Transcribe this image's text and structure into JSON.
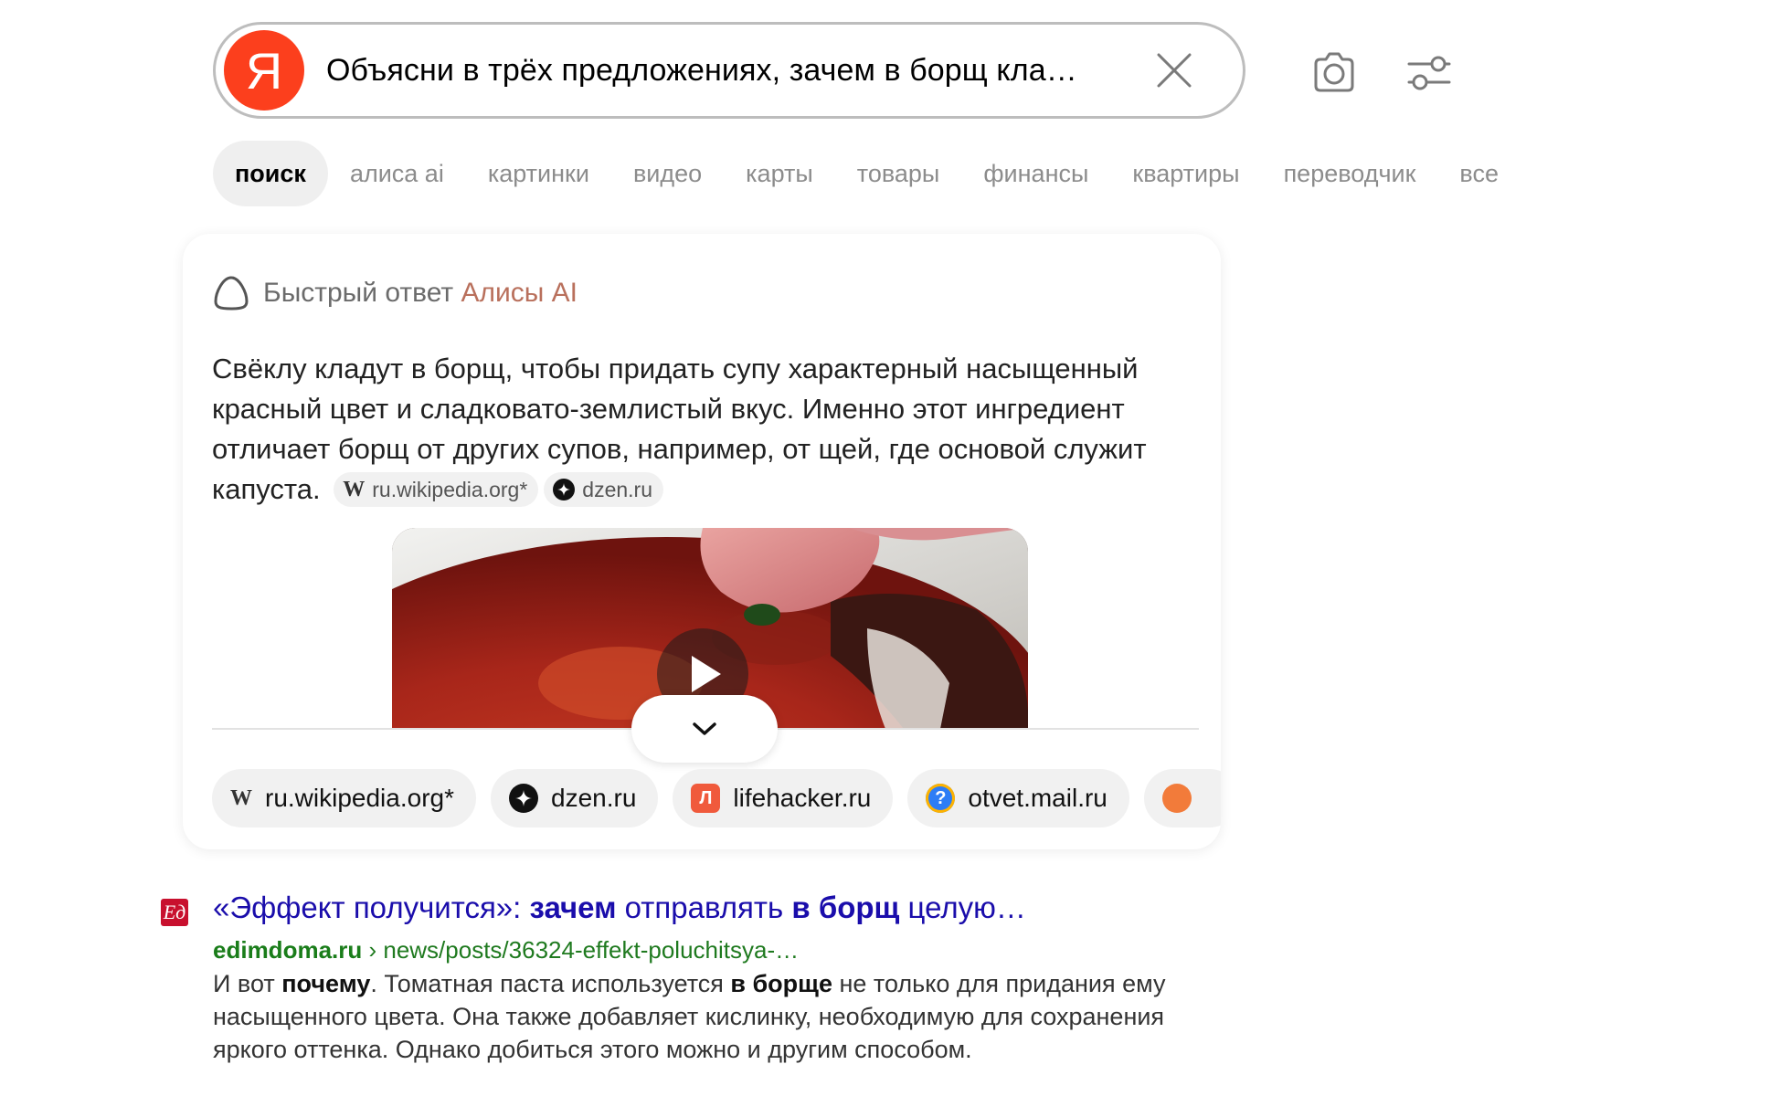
{
  "search": {
    "logo_letter": "Я",
    "query": "Объясни в трёх предложениях, зачем в борщ кла…"
  },
  "tabs": [
    {
      "label": "поиск",
      "active": true
    },
    {
      "label": "алиса ai"
    },
    {
      "label": "картинки"
    },
    {
      "label": "видео"
    },
    {
      "label": "карты"
    },
    {
      "label": "товары"
    },
    {
      "label": "финансы"
    },
    {
      "label": "квартиры"
    },
    {
      "label": "переводчик"
    },
    {
      "label": "все"
    }
  ],
  "alice": {
    "header_prefix": "Быстрый ответ",
    "header_accent": "Алисы AI",
    "answer": "Свёклу кладут в борщ, чтобы придать супу характерный насыщенный красный цвет и сладковато-землистый вкус. Именно этот ингредиент отличает борщ от других супов, например, от щей, где основой служит капуста.",
    "inline_sources": [
      {
        "icon": "W",
        "label": "ru.wikipedia.org*"
      },
      {
        "label": "dzen.ru"
      }
    ],
    "sources": [
      {
        "icon": "W",
        "label": "ru.wikipedia.org*"
      },
      {
        "label": "dzen.ru"
      },
      {
        "icon": "Л",
        "label": "lifehacker.ru"
      },
      {
        "icon": "?",
        "label": "otvet.mail.ru"
      }
    ]
  },
  "result": {
    "favicon_letter": "Ед",
    "title_parts": [
      {
        "text": "«Эффект получится»: ",
        "bold": false
      },
      {
        "text": "зачем",
        "bold": true
      },
      {
        "text": " отправлять ",
        "bold": false
      },
      {
        "text": "в борщ",
        "bold": true
      },
      {
        "text": " целую…",
        "bold": false
      }
    ],
    "domain": "edimdoma.ru",
    "path": " › news/posts/36324-effekt-poluchitsya-…",
    "snippet_parts": [
      {
        "text": "И вот ",
        "bold": false
      },
      {
        "text": "почему",
        "bold": true
      },
      {
        "text": ". Томатная паста используется ",
        "bold": false
      },
      {
        "text": "в борще",
        "bold": true
      },
      {
        "text": " не только для придания ему насыщенного цвета. Она также добавляет кислинку, необходимую для сохранения яркого оттенка. Однако добиться этого можно и другим способом.",
        "bold": false
      }
    ]
  },
  "colors": {
    "yandex_red": "#fc3f1d",
    "link_blue": "#1a0dab",
    "url_green": "#1f7a1f",
    "alice_accent": "#b9705c"
  }
}
